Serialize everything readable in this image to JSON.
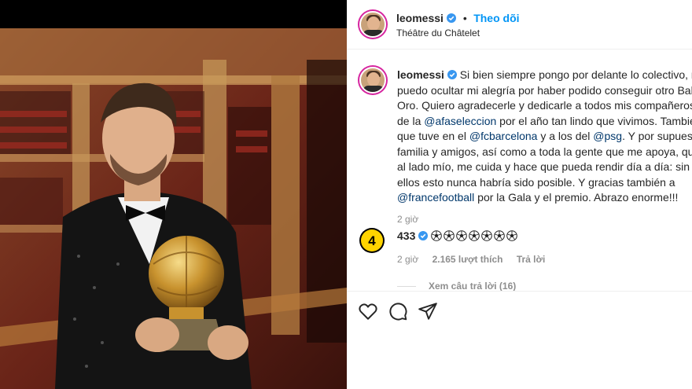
{
  "post": {
    "username": "leomessi",
    "dot": "•",
    "follow_label": "Theo dõi",
    "location": "Théâtre du Châtelet"
  },
  "caption": {
    "username": "leomessi",
    "line1": "Si bien siempre pongo por delante lo colectivo, no",
    "line2": "puedo ocultar mi alegría por haber podido conseguir otro Balón",
    "line3": "Oro. Quiero agradecerle y dedicarle a todos mis compañeros y s",
    "line4_pre": "de la ",
    "line4_mention": "@afaseleccion",
    "line4_post": " por el año tan lindo que vivimos. También a",
    "line5_pre": "que tuve en el ",
    "line5_mention1": "@fcbarcelona",
    "line5_mid": " y a los del ",
    "line5_mention2": "@psg",
    "line5_post": ". Y por supuesto a",
    "line6": "familia y amigos, así como a toda la gente que me apoya, que es",
    "line7": "al lado mío, me cuida y hace que pueda rendir día a día: sin todo",
    "line8": "ellos esto nunca habría sido posible. Y gracias también a",
    "line9_mention": "@francefootball",
    "line9_post": " por la Gala y el premio. Abrazo enorme!!!",
    "time": "2 giờ"
  },
  "comment": {
    "avatar_text": "4",
    "username": "433",
    "ball_count": 7,
    "time": "2 giờ",
    "likes": "2.165 lượt thích",
    "reply_label": "Trả lời",
    "view_replies": "Xem câu trả lời (16)"
  },
  "icons": [
    "heart-icon",
    "comment-icon",
    "share-icon",
    "verified-icon",
    "soccer-ball-icon"
  ],
  "colors": {
    "accent": "#0095f6",
    "mention": "#00376b",
    "muted": "#8e8e8e",
    "verified": "#3897f0",
    "badge": "#ffd400"
  }
}
